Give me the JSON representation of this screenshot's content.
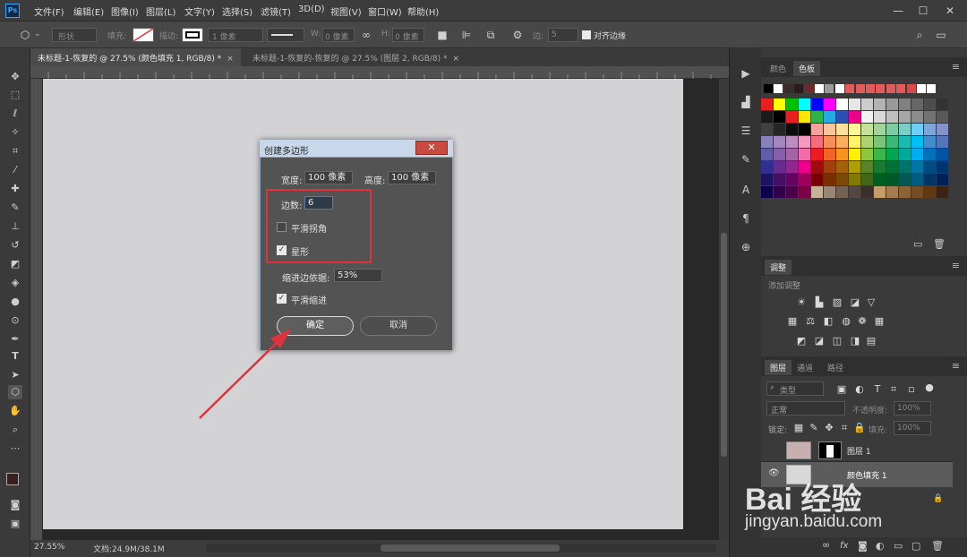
{
  "app": {
    "logo": "Ps"
  },
  "menu": [
    "文件(F)",
    "编辑(E)",
    "图像(I)",
    "图层(L)",
    "文字(Y)",
    "选择(S)",
    "滤镜(T)",
    "3D(D)",
    "视图(V)",
    "窗口(W)",
    "帮助(H)"
  ],
  "window_controls": {
    "minimize": "—",
    "maximize": "☐",
    "close": "✕"
  },
  "options_bar": {
    "mode": "形状",
    "fill_label": "填充:",
    "stroke_label": "描边:",
    "stroke_width": "1 像素",
    "w_label": "W:",
    "w_value": "0 像素",
    "h_label": "H:",
    "h_value": "0 像素",
    "edge_label": "边:",
    "edge_value": "5",
    "align_edges_label": "对齐边缘",
    "align_edges_checked": true
  },
  "tabs": [
    {
      "label": "未标题-1-恢复的 @ 27.5% (颜色填充 1, RGB/8) *",
      "close": "×",
      "active": true
    },
    {
      "label": "未标题-1-恢复的-恢复的 @ 27.5% (图层 2, RGB/8) *",
      "close": "×",
      "active": false
    }
  ],
  "status": {
    "zoom": "27.55%",
    "doc": "文档:24.9M/38.1M"
  },
  "dialog": {
    "title": "创建多边形",
    "close": "✕",
    "width_label": "宽度:",
    "width_value": "100 像素",
    "height_label": "高度:",
    "height_value": "100 像素",
    "sides_label": "边数:",
    "sides_value": "6",
    "smooth_corners_label": "平滑拐角",
    "smooth_corners_checked": false,
    "star_label": "星形",
    "star_checked": true,
    "indent_label": "缩进边依据:",
    "indent_value": "53%",
    "smooth_indent_label": "平滑缩进",
    "smooth_indent_checked": true,
    "ok_label": "确定",
    "cancel_label": "取消",
    "checkmark": "✓"
  },
  "swatches_panel": {
    "tabs": [
      "颜色",
      "色板"
    ],
    "menu": "≡",
    "top_row": [
      "#000000",
      "#ffffff",
      "#3a2a2a",
      "#2b1b1b",
      "#6b2b2b",
      "#ffffff",
      "#9a9a9a",
      "#ffffff",
      "#e45a5a",
      "#e45a5a",
      "#e45a5a",
      "#e45a5a",
      "#e45a5a",
      "#e45a5a",
      "#d94a4a",
      "#ffffff",
      "#ffffff"
    ],
    "rows": [
      [
        "#e62020",
        "#ffff00",
        "#00c000",
        "#00ffff",
        "#0000ff",
        "#ff00ff",
        "#ffffff",
        "#e6e6e6",
        "#cccccc",
        "#b3b3b3",
        "#999999",
        "#808080",
        "#666666",
        "#4d4d4d",
        "#333333"
      ],
      [
        "#1a1a1a",
        "#000000",
        "#e62020",
        "#ffe600",
        "#2db34a",
        "#27aae1",
        "#2b4fb5",
        "#ec008c",
        "#f2f2f2",
        "#d9d9d9",
        "#bfbfbf",
        "#a6a6a6",
        "#8c8c8c",
        "#737373",
        "#595959"
      ],
      [
        "#404040",
        "#262626",
        "#0d0d0d",
        "#000000",
        "#f7a29a",
        "#fbc59b",
        "#fde199",
        "#fff799",
        "#c5e09b",
        "#a3d39c",
        "#7fcba4",
        "#7ccdc8",
        "#6dcff6",
        "#7da7d9",
        "#8393ca"
      ],
      [
        "#8882be",
        "#a187be",
        "#bc8dbf",
        "#f49ac1",
        "#f26d7d",
        "#f68e55",
        "#fbaf5d",
        "#fff467",
        "#acd372",
        "#7cc576",
        "#3bb878",
        "#1abbb4",
        "#00bff3",
        "#438ccb",
        "#5574b9"
      ],
      [
        "#605ca8",
        "#855fa8",
        "#a763a8",
        "#f06eaa",
        "#ed1c24",
        "#f26522",
        "#f7941d",
        "#fff200",
        "#8dc63f",
        "#39b54a",
        "#00a651",
        "#00a99d",
        "#00aeef",
        "#0072bc",
        "#0054a6"
      ],
      [
        "#2e3192",
        "#662d91",
        "#92278f",
        "#ec008c",
        "#9e0b0f",
        "#a0410d",
        "#a36209",
        "#aba000",
        "#598527",
        "#197b30",
        "#007236",
        "#00746b",
        "#0076a3",
        "#004b80",
        "#003471"
      ],
      [
        "#1b1464",
        "#440e62",
        "#630460",
        "#9e005d",
        "#790000",
        "#7b2e00",
        "#7d4900",
        "#827b00",
        "#406618",
        "#005e20",
        "#005826",
        "#005952",
        "#005b7f",
        "#003663",
        "#002157"
      ],
      [
        "#0d004c",
        "#32004b",
        "#4b0049",
        "#7b0046",
        "#c7b299",
        "#998675",
        "#736357",
        "#534741",
        "#37302d",
        "#c69c6d",
        "#a67c52",
        "#8c6239",
        "#754c24",
        "#603913",
        "#3c2415"
      ]
    ],
    "footer_icons": [
      "new-swatch-icon",
      "trash-icon"
    ]
  },
  "adjustments_panel": {
    "tab": "调整",
    "menu": "≡",
    "add_label": "添加调整"
  },
  "layers_panel": {
    "tabs": [
      "图层",
      "通道",
      "路径"
    ],
    "menu": "≡",
    "filter_label": "类型",
    "blend_mode": "正常",
    "opacity_label": "不透明度:",
    "opacity_value": "100%",
    "lock_label": "锁定:",
    "fill_label": "填充:",
    "fill_value": "100%",
    "layers": [
      {
        "name": "图层 1",
        "visible": false
      },
      {
        "name": "颜色填充 1",
        "visible": true
      }
    ],
    "footer_fx": "fx"
  },
  "watermark": {
    "logo": "Bai  经验",
    "url": "jingyan.baidu.com"
  },
  "colors": {
    "accent_red": "#e0323b",
    "ps_blue": "#31a8ff",
    "dialog_title_bg": "#c8d8ea",
    "canvas": "#d3d3d6"
  }
}
